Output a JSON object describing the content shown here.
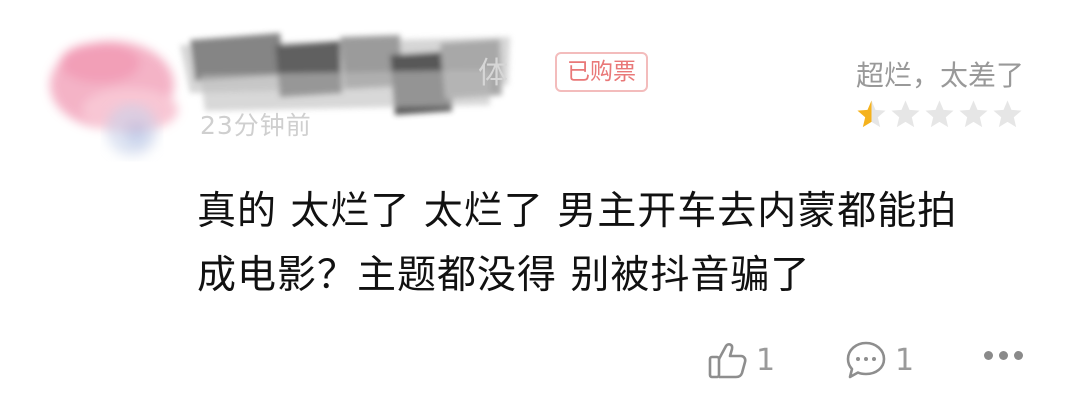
{
  "comment": {
    "username_visible_tail": "体",
    "time_text": "23分钟前",
    "badge": "已购票",
    "rating_label": "超烂，太差了",
    "rating_stars": 0.5,
    "rating_max": 5,
    "body_lines": [
      "真的 太烂了 太烂了 男主开车去内蒙都能拍",
      "成电影？主题都没得 别被抖音骗了"
    ],
    "like_count": "1",
    "reply_count": "1"
  },
  "colors": {
    "badge_text": "#e97878",
    "badge_border": "#f3bcbc",
    "star_filled": "#f5b21c",
    "star_empty": "#e6e6e6",
    "muted_text": "#999999",
    "body_text": "#111111"
  },
  "icons": {
    "like": "thumbs-up-icon",
    "reply": "comment-bubble-icon",
    "more": "more-dots-icon",
    "star": "star-icon"
  }
}
